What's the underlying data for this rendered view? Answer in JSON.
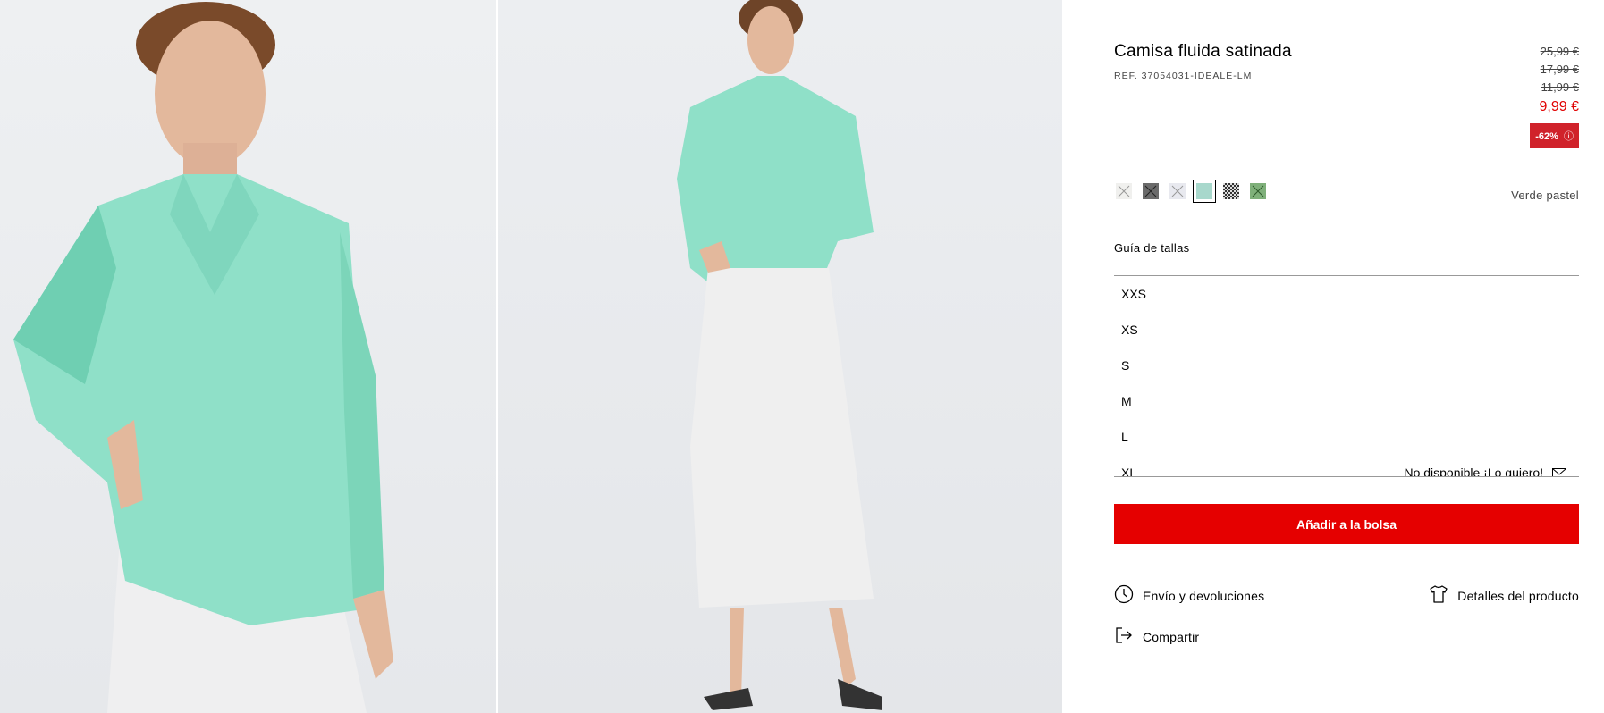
{
  "product": {
    "title": "Camisa fluida satinada",
    "ref": "REF. 37054031-IDEALE-LM",
    "old_prices": [
      "25,99 €",
      "17,99 €",
      "11,99 €"
    ],
    "current_price": "9,99 €",
    "discount": "-62%"
  },
  "colors": {
    "selected_name": "Verde pastel",
    "swatches": [
      {
        "color": "#f0f0ee",
        "available": false
      },
      {
        "color": "#6b6b6b",
        "available": false
      },
      {
        "color": "#e8e9ef",
        "available": false
      },
      {
        "color": "#a8d8cc",
        "available": true,
        "selected": true
      },
      {
        "color": "#555555",
        "available": true
      },
      {
        "color": "#7fb07a",
        "available": false
      }
    ]
  },
  "size_guide_label": "Guía de tallas",
  "sizes": {
    "items": [
      "XXS",
      "XS",
      "S",
      "M",
      "L",
      "XL"
    ],
    "unavailable_text": "No disponible ¡Lo quiero!"
  },
  "add_to_bag_label": "Añadir a la bolsa",
  "links": {
    "shipping": "Envío y devoluciones",
    "details": "Detalles del producto",
    "share": "Compartir"
  }
}
